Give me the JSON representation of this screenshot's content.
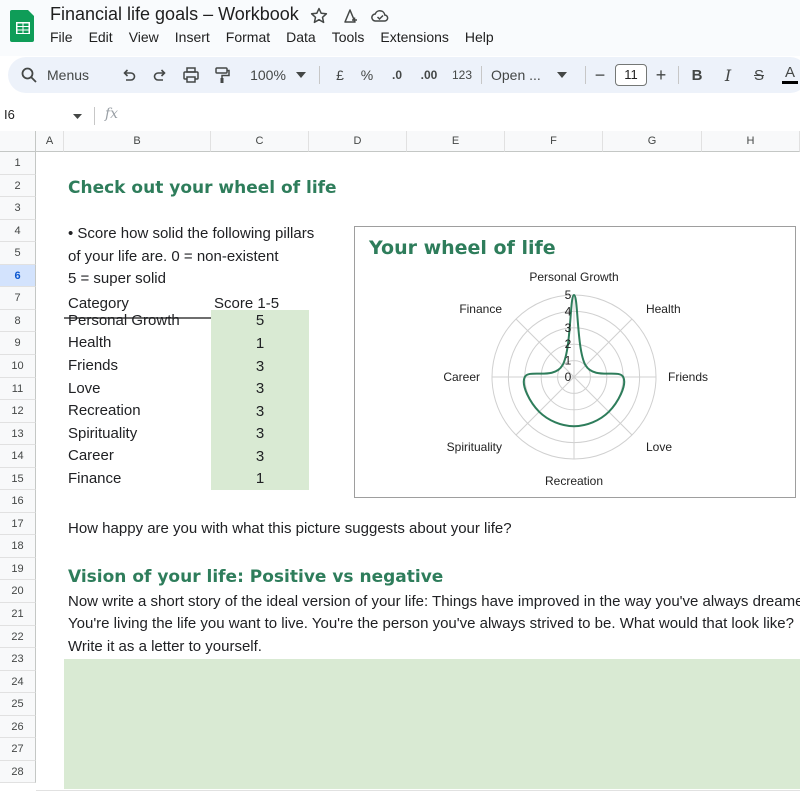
{
  "app": {
    "title": "Financial life goals – Workbook",
    "menu": [
      "File",
      "Edit",
      "View",
      "Insert",
      "Format",
      "Data",
      "Tools",
      "Extensions",
      "Help"
    ]
  },
  "toolbar": {
    "menus_label": "Menus",
    "zoom": "100%",
    "currency": "£",
    "percent": "%",
    "decrease_decimal": ".0",
    "increase_decimal": ".00",
    "number_format": "123",
    "font_name": "Open ...",
    "font_size": "11",
    "minus": "−",
    "plus": "+",
    "bold": "B",
    "italic": "I",
    "strike": "S",
    "text_color": "A"
  },
  "formula_bar": {
    "cell_ref": "I6",
    "fx": "fx"
  },
  "columns": [
    "A",
    "B",
    "C",
    "D",
    "E",
    "F",
    "G",
    "H"
  ],
  "rows": [
    "1",
    "2",
    "3",
    "4",
    "5",
    "6",
    "7",
    "8",
    "9",
    "10",
    "11",
    "12",
    "13",
    "14",
    "15",
    "16",
    "17",
    "18",
    "19",
    "20",
    "21",
    "22",
    "23",
    "24",
    "25",
    "26",
    "27",
    "28"
  ],
  "sheet": {
    "heading1": "Check out your wheel of life",
    "instruction_line1": "• Score how solid the following pillars",
    "instruction_line2": "of your life are. 0 = non-existent",
    "instruction_line3": "5 = super solid",
    "col_category": "Category",
    "col_score": "Score 1-5",
    "scores": [
      {
        "category": "Personal Growth",
        "score": "5"
      },
      {
        "category": "Health",
        "score": "1"
      },
      {
        "category": "Friends",
        "score": "3"
      },
      {
        "category": "Love",
        "score": "3"
      },
      {
        "category": "Recreation",
        "score": "3"
      },
      {
        "category": "Spirituality",
        "score": "3"
      },
      {
        "category": "Career",
        "score": "3"
      },
      {
        "category": "Finance",
        "score": "1"
      }
    ],
    "question": "How happy are you with what this picture suggests about your life?",
    "heading2": "Vision of your life: Positive vs negative",
    "story_line1": "Now write a short story of the ideal version of your life: Things have improved in the way you've always dreame",
    "story_line2": "You're living the life you want to live. You're the person you've always strived to be. What would that look like?",
    "story_line3": "Write it as a letter to yourself."
  },
  "chart_data": {
    "type": "radar",
    "title": "Your wheel of life",
    "categories": [
      "Personal Growth",
      "Health",
      "Friends",
      "Love",
      "Recreation",
      "Spirituality",
      "Career",
      "Finance"
    ],
    "series": [
      {
        "values": [
          5,
          1,
          3,
          3,
          3,
          3,
          3,
          1
        ]
      }
    ],
    "r_ticks": [
      "0",
      "1",
      "2",
      "3",
      "4",
      "5"
    ],
    "rlim": [
      0,
      5
    ],
    "grid": true,
    "series_color": "#2e7d5b"
  },
  "colors": {
    "accent_green": "#2e7d5b",
    "score_fill": "#d9ead3",
    "selected_row": "#d3e3fd"
  }
}
